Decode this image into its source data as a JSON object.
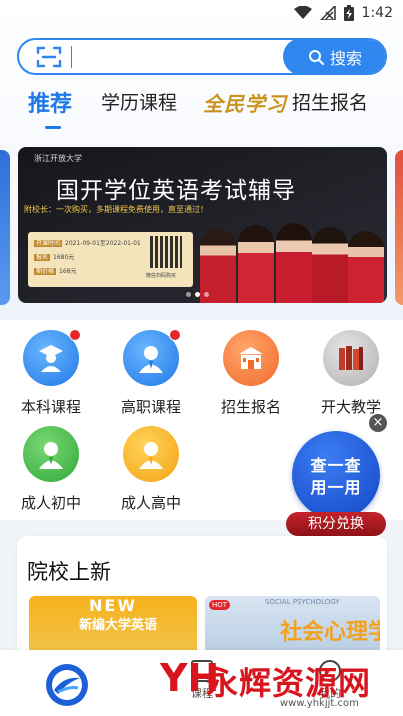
{
  "status_bar": {
    "time": "1:42"
  },
  "search": {
    "placeholder": "",
    "button_label": "搜索"
  },
  "tabs": [
    {
      "label": "推荐",
      "active": true
    },
    {
      "label": "学历课程",
      "active": false
    },
    {
      "label": "全民学习",
      "active": false
    },
    {
      "label": "招生报名",
      "active": false
    }
  ],
  "banner": {
    "school": "浙江开放大学",
    "title": "国开学位英语考试辅导",
    "subtitle": "附校长：一次购买，多期课程免费使用，直至通过！",
    "lines": [
      {
        "tag": "开课时间",
        "text": "2021-09-01至2022-01-01"
      },
      {
        "tag": "报名",
        "text": "1680元"
      },
      {
        "tag": "期价格",
        "text": "168元"
      }
    ],
    "qr_label": "微信扫码购买",
    "slide_index": 2,
    "slide_count": 3
  },
  "entries": [
    {
      "label": "本科课程",
      "icon": "graduate-icon",
      "badge": true
    },
    {
      "label": "高职课程",
      "icon": "student-icon",
      "badge": true
    },
    {
      "label": "招生报名",
      "icon": "school-building-icon",
      "badge": false
    },
    {
      "label": "开大教学",
      "icon": "books-icon",
      "badge": false
    },
    {
      "label": "成人初中",
      "icon": "adult-student-icon",
      "badge": false
    },
    {
      "label": "成人高中",
      "icon": "adult-student-icon",
      "badge": false
    }
  ],
  "floating": {
    "line1": "查一查",
    "line2": "用一用",
    "bar": "积分兑换",
    "close": "×"
  },
  "schools": {
    "title": "院校上新",
    "cards": [
      {
        "hot": "",
        "title": "新编大学英语",
        "tag": "NEW"
      },
      {
        "hot": "HOT",
        "title": "社会心理学",
        "tag": "SOCIAL PSYCHOLOGY"
      }
    ]
  },
  "bottom_nav": {
    "items": [
      {
        "label": "",
        "icon": "home-logo-icon"
      },
      {
        "label": "课程",
        "icon": "course-icon"
      },
      {
        "label": "我的",
        "icon": "profile-icon"
      }
    ]
  },
  "watermark": {
    "logo": "YH",
    "text": "永辉资源网",
    "url": "www.yhkjjt.com"
  },
  "colors": {
    "accent": "#2e86ee",
    "red": "#e4262b",
    "promo": "#1346c6"
  }
}
